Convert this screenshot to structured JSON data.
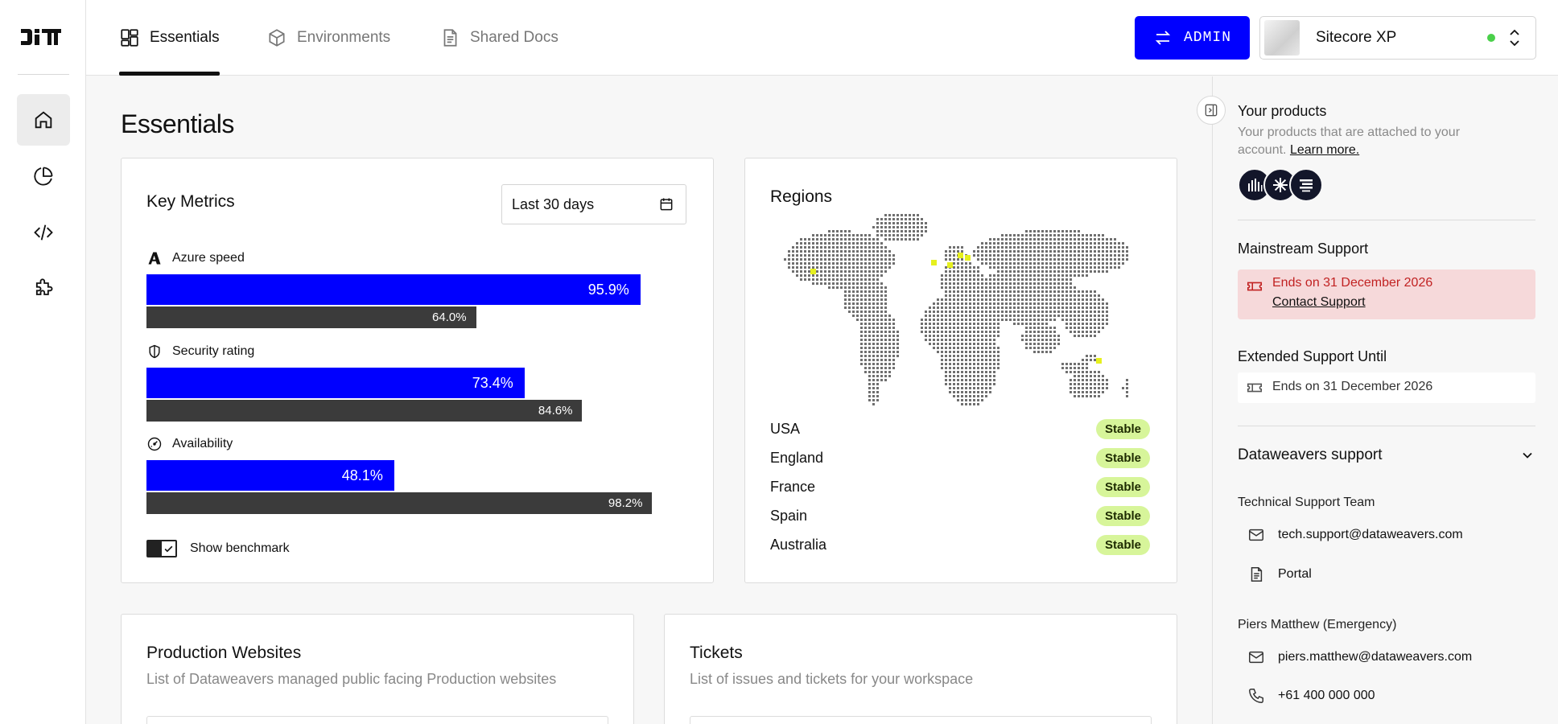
{
  "tabs": [
    {
      "label": "Essentials"
    },
    {
      "label": "Environments"
    },
    {
      "label": "Shared Docs"
    }
  ],
  "admin_button": {
    "label": "ADMIN",
    "color": "#0000ff"
  },
  "site_selector": {
    "value": "Sitecore XP",
    "status_color": "#4ad04a"
  },
  "page_title": "Essentials",
  "key_metrics": {
    "title": "Key Metrics",
    "date_range": "Last 30 days",
    "metrics": [
      {
        "label": "Azure speed",
        "icon": "azure-icon",
        "value": 95.9,
        "value_label": "95.9%",
        "benchmark": 64.0,
        "benchmark_label": "64.0%"
      },
      {
        "label": "Security rating",
        "icon": "shield-icon",
        "value": 73.4,
        "value_label": "73.4%",
        "benchmark": 84.6,
        "benchmark_label": "84.6%"
      },
      {
        "label": "Availability",
        "icon": "gauge-icon",
        "value": 48.1,
        "value_label": "48.1%",
        "benchmark": 98.2,
        "benchmark_label": "98.2%"
      }
    ],
    "show_benchmark_label": "Show benchmark",
    "show_benchmark": true
  },
  "regions": {
    "title": "Regions",
    "items": [
      {
        "name": "USA",
        "status": "Stable"
      },
      {
        "name": "England",
        "status": "Stable"
      },
      {
        "name": "France",
        "status": "Stable"
      },
      {
        "name": "Spain",
        "status": "Stable"
      },
      {
        "name": "Australia",
        "status": "Stable"
      }
    ],
    "highlight_color": "#e6f01e"
  },
  "production_websites": {
    "title": "Production Websites",
    "subtitle": "List of Dataweavers managed public facing Production websites"
  },
  "tickets": {
    "title": "Tickets",
    "subtitle": "List of issues and tickets for your workspace"
  },
  "right_panel": {
    "products_title": "Your products",
    "products_text": "Your products that are attached to your account.",
    "learn_more": "Learn more.",
    "mainstream_title": "Mainstream Support",
    "mainstream_ends": "Ends on 31 December 2026",
    "contact_support": "Contact Support",
    "extended_title": "Extended Support Until",
    "extended_ends": "Ends on 31 December 2026",
    "dataweavers_title": "Dataweavers support",
    "team_label": "Technical Support Team",
    "team_email": "tech.support@dataweavers.com",
    "portal_label": "Portal",
    "emergency_label": "Piers Matthew (Emergency)",
    "emergency_email": "piers.matthew@dataweavers.com",
    "emergency_phone": "+61 400 000 000"
  }
}
